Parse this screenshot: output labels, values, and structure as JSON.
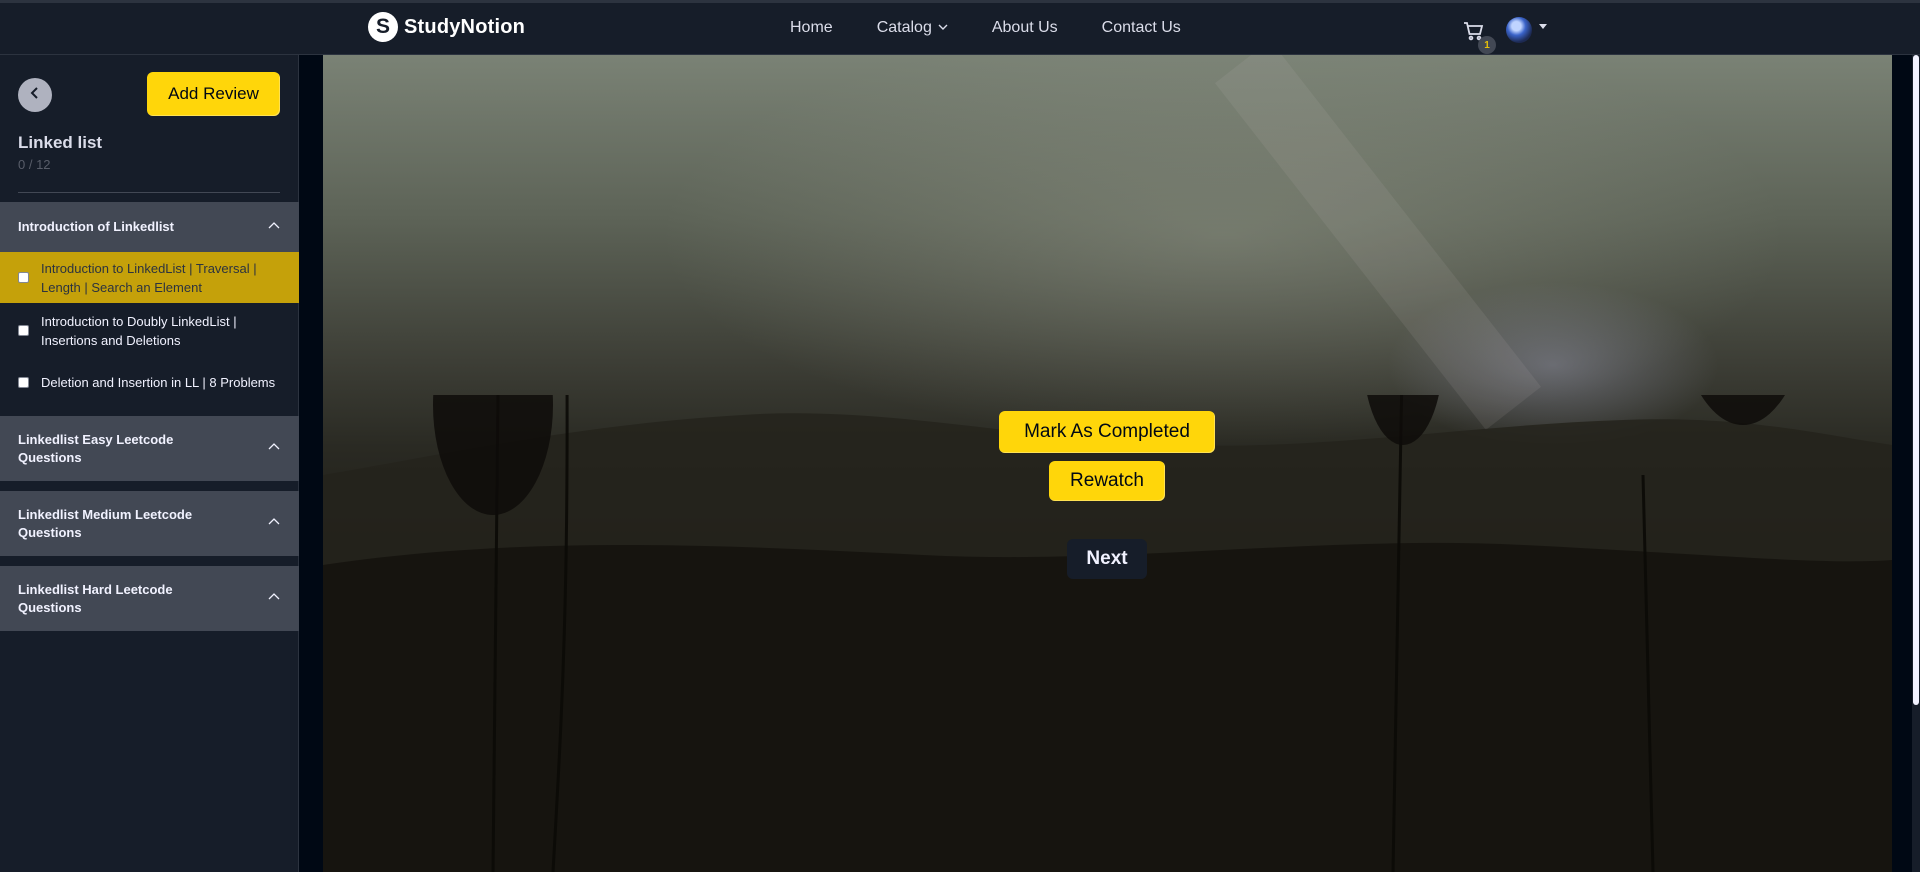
{
  "header": {
    "brand": "StudyNotion",
    "brand_mark": "S",
    "nav": [
      {
        "label": "Home"
      },
      {
        "label": "Catalog"
      },
      {
        "label": "About Us"
      },
      {
        "label": "Contact Us"
      }
    ],
    "cart_count": "1"
  },
  "sidebar": {
    "add_review_label": "Add Review",
    "course_title": "Linked list",
    "progress": "0 / 12",
    "sections": [
      {
        "title": "Introduction of Linkedlist",
        "expanded": true,
        "lectures": [
          {
            "title": "Introduction to LinkedList | Traversal | Length | Search an Element",
            "active": true,
            "completed": false
          },
          {
            "title": "Introduction to Doubly LinkedList | Insertions and Deletions",
            "active": false,
            "completed": false
          },
          {
            "title": "Deletion and Insertion in LL | 8 Problems",
            "active": false,
            "completed": false
          }
        ]
      },
      {
        "title": "Linkedlist Easy Leetcode Questions",
        "expanded": false
      },
      {
        "title": "Linkedlist Medium Leetcode Questions",
        "expanded": false
      },
      {
        "title": "Linkedlist Hard Leetcode Questions",
        "expanded": false
      }
    ]
  },
  "video": {
    "mark_completed_label": "Mark As Completed",
    "rewatch_label": "Rewatch",
    "next_label": "Next"
  },
  "colors": {
    "accent": "#ffd60a",
    "active_lecture": "#c5a10a",
    "sidebar_bg": "#161d29",
    "section_bg": "#424854"
  },
  "icons": [
    "back-arrow-icon",
    "cart-icon",
    "chevron-down-icon",
    "chevron-up-icon",
    "checkbox-icon",
    "avatar"
  ]
}
